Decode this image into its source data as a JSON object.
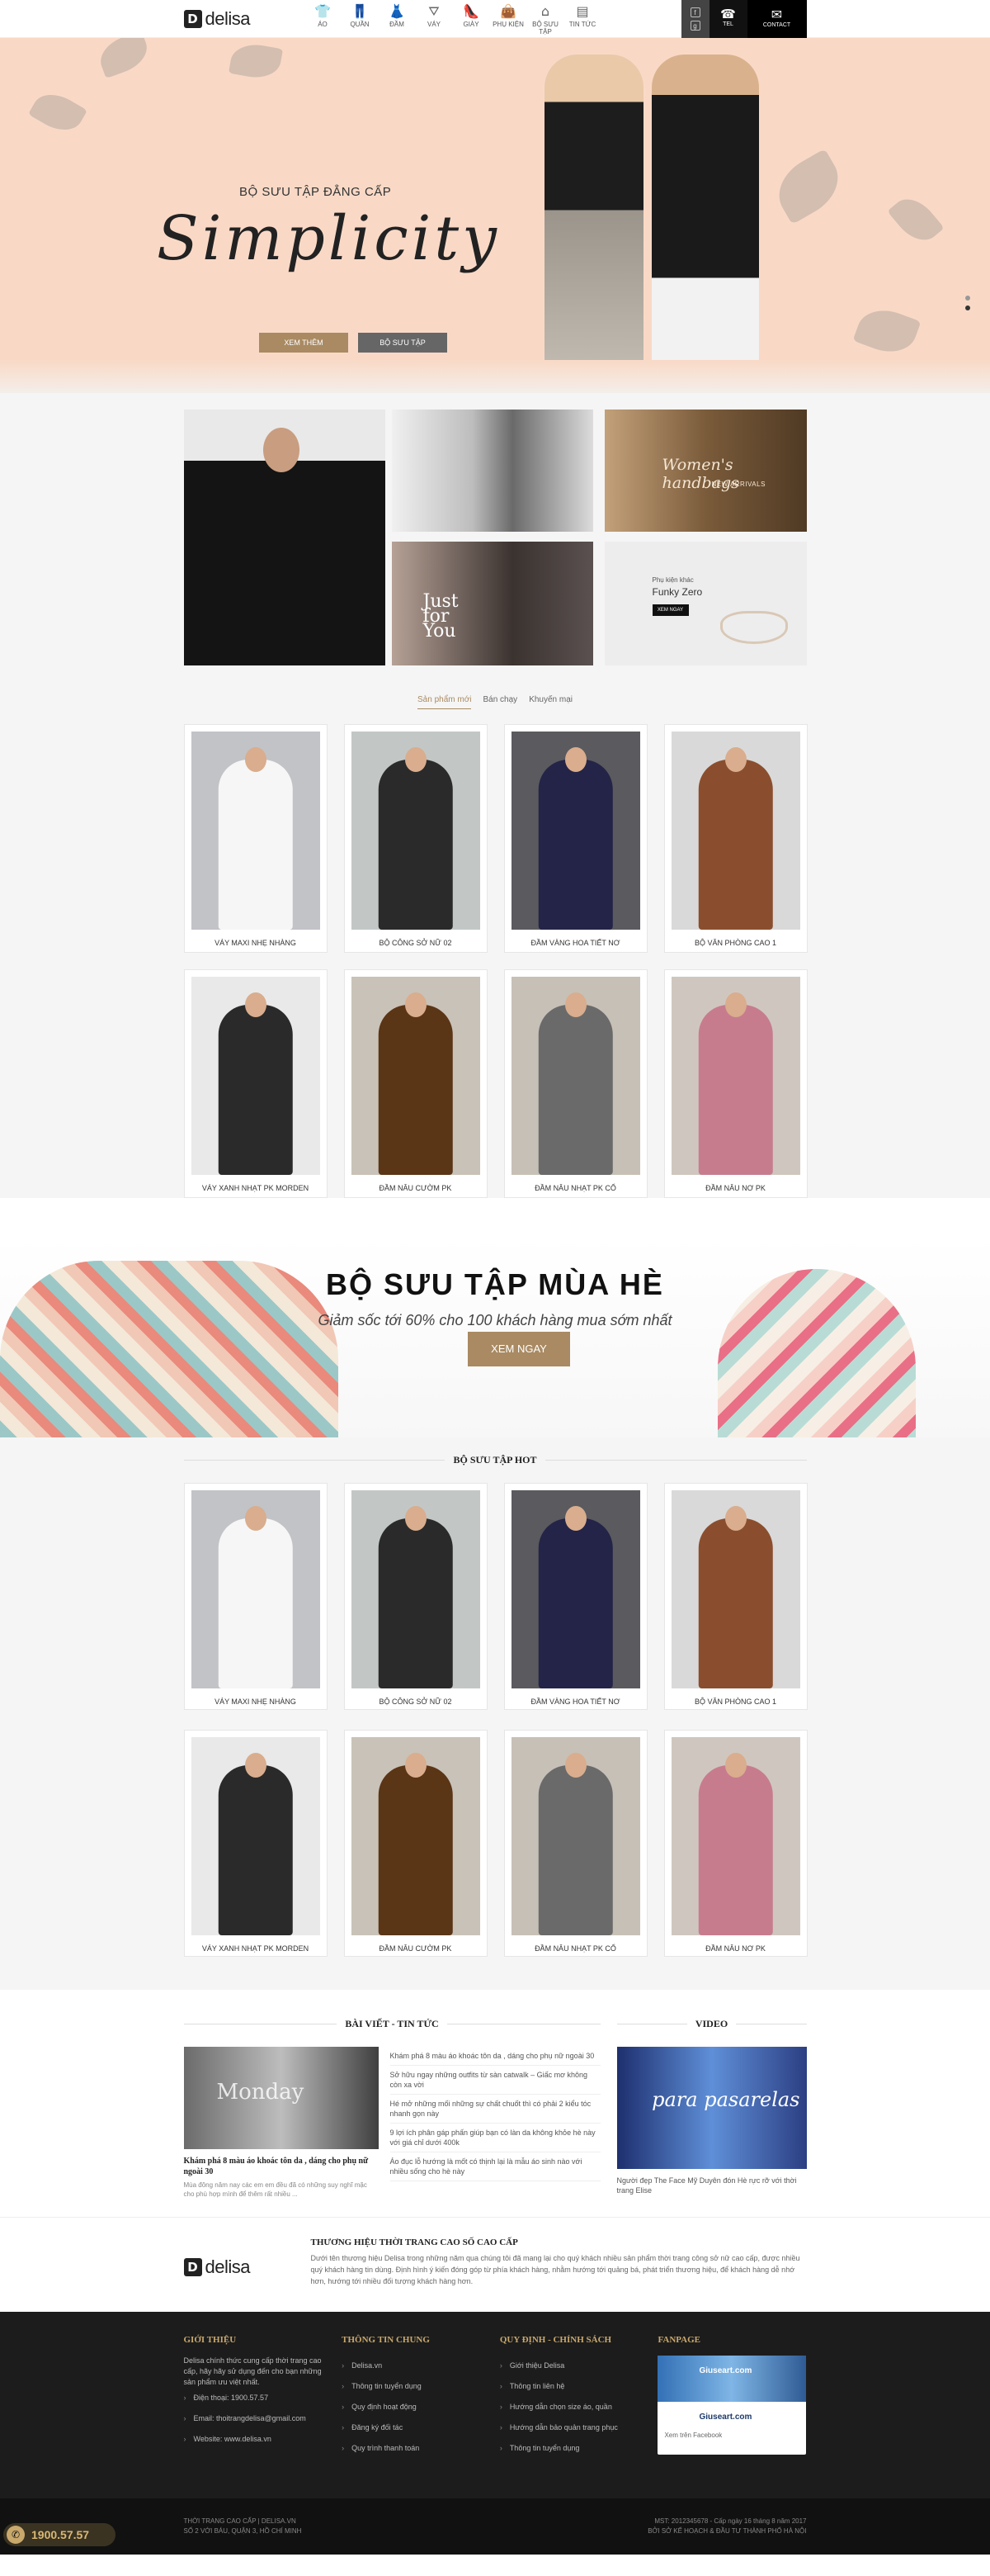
{
  "header": {
    "brand": "delisa",
    "brand_mark": "D",
    "nav": [
      {
        "label": "ÁO",
        "icon": "shirt-icon",
        "glyph": "👕"
      },
      {
        "label": "QUẦN",
        "icon": "trousers-icon",
        "glyph": "👖"
      },
      {
        "label": "ĐẦM",
        "icon": "dress-icon",
        "glyph": "👗"
      },
      {
        "label": "VÁY",
        "icon": "skirt-icon",
        "glyph": "⛛"
      },
      {
        "label": "GIÀY",
        "icon": "shoe-icon",
        "glyph": "👠"
      },
      {
        "label": "PHỤ KIỆN",
        "icon": "handbag-icon",
        "glyph": "👜"
      },
      {
        "label": "BỘ SƯU TẬP",
        "icon": "hanger-icon",
        "glyph": "⌂"
      },
      {
        "label": "TIN TỨC",
        "icon": "news-icon",
        "glyph": "▤"
      }
    ],
    "tel_label": "TEL",
    "contact_label": "CONTACT",
    "social_icons": [
      "facebook-icon",
      "google-plus-icon"
    ]
  },
  "hero": {
    "subtitle": "BỘ SƯU TẬP ĐẲNG CẤP",
    "title": "Simplicity",
    "btn_primary": "XEM THÊM",
    "btn_secondary": "BỘ SƯU TẬP"
  },
  "banners": {
    "handbags_title": "Women's handbags",
    "handbags_sub": "NEW ARRIVALS",
    "justforyou": "Just for You",
    "accessory_kicker": "Phụ kiện khác",
    "accessory_title": "Funky Zero",
    "accessory_btn": "XEM NGAY"
  },
  "tabs": [
    "Sản phẩm mới",
    "Bán chạy",
    "Khuyến mại"
  ],
  "products": [
    {
      "name": "VÁY MAXI NHẸ NHÀNG",
      "colors": [
        "#c2c3c7",
        "#f6f6f6"
      ]
    },
    {
      "name": "BỘ CÔNG SỞ NỮ 02",
      "colors": [
        "#c2c7c6",
        "#2a2a2a"
      ]
    },
    {
      "name": "ĐẦM VÀNG HOA TIẾT NƠ",
      "colors": [
        "#5a5a5f",
        "#232447"
      ]
    },
    {
      "name": "BỘ VĂN PHÒNG CAO 1",
      "colors": [
        "#d9d9d9",
        "#8a4e2e"
      ]
    },
    {
      "name": "VÁY XANH NHẠT PK MORDEN",
      "colors": [
        "#e9e9e9",
        "#2a2a2a"
      ]
    },
    {
      "name": "ĐẦM NÂU CƯỜM PK",
      "colors": [
        "#c9c2b8",
        "#5a3516"
      ]
    },
    {
      "name": "ĐẦM NÂU NHẠT PK CỔ",
      "colors": [
        "#c7c0b6",
        "#6a6a6a"
      ]
    },
    {
      "name": "ĐẦM NÂU NƠ PK",
      "colors": [
        "#cfc7bf",
        "#c77c8e"
      ]
    }
  ],
  "summer": {
    "title": "BỘ SƯU TẬP MÙA HÈ",
    "desc": "Giảm sốc tới 60% cho 100 khách hàng mua sớm nhất",
    "btn": "XEM NGAY"
  },
  "collection": {
    "title": "BỘ SƯU TẬP HOT",
    "products": [
      {
        "name": "VÁY MAXI NHẸ NHÀNG",
        "colors": [
          "#c2c3c7",
          "#f6f6f6"
        ]
      },
      {
        "name": "BỘ CÔNG SỞ NỮ 02",
        "colors": [
          "#c2c7c6",
          "#2a2a2a"
        ]
      },
      {
        "name": "ĐẦM VÀNG HOA TIẾT NƠ",
        "colors": [
          "#5a5a5f",
          "#232447"
        ]
      },
      {
        "name": "BỘ VĂN PHÒNG CAO 1",
        "colors": [
          "#d9d9d9",
          "#8a4e2e"
        ]
      },
      {
        "name": "VÁY XANH NHẠT PK MORDEN",
        "colors": [
          "#e9e9e9",
          "#2a2a2a"
        ]
      },
      {
        "name": "ĐẦM NÂU CƯỜM PK",
        "colors": [
          "#c9c2b8",
          "#5a3516"
        ]
      },
      {
        "name": "ĐẦM NÂU NHẠT PK CỔ",
        "colors": [
          "#c7c0b6",
          "#6a6a6a"
        ]
      },
      {
        "name": "ĐẦM NÂU NƠ PK",
        "colors": [
          "#cfc7bf",
          "#c77c8e"
        ]
      }
    ]
  },
  "news": {
    "title": "BÀI VIẾT - TIN TỨC",
    "featured_image_text": "Monday",
    "featured_title": "Khám phá 8 màu áo khoác tôn da , dáng cho phụ nữ ngoài 30",
    "featured_desc": "Mùa đông năm nay các em em đều đã có những suy nghĩ mặc cho phù hợp mình để thêm rất nhiều ...",
    "items": [
      "Khám phá 8 màu áo khoác tôn da , dáng cho phụ nữ ngoài 30",
      "Sở hữu ngay những outfits từ sàn catwalk – Giấc mơ không còn xa vời",
      "Hé mở những mối những sự chất chuốt thì có phải 2 kiểu tóc nhanh gọn này",
      "9 lợi ích phân gáp phấn giúp bạn có làn da không khỏe hè này với giá chỉ dưới 400k",
      "Áo đục lỗ hướng là mốt có thịnh lại là mẫu áo sinh nào với nhiều sống cho hè này"
    ]
  },
  "video": {
    "title": "VIDEO",
    "thumb_text": "para pasarelas",
    "caption": "Người đẹp The Face Mỹ Duyên đón Hè rực rỡ với thời trang Elise"
  },
  "brand": {
    "title": "THƯƠNG HIỆU THỜI TRANG CAO SỐ CAO CẤP",
    "desc": "Dưới tên thương hiệu Delisa trong những năm qua chúng tôi đã mang lại cho quý khách nhiều sản phẩm thời trang công sở nữ cao cấp, được nhiều quý khách hàng tin dùng. Định hình ý kiến đóng góp từ phía khách hàng, nhằm hướng tới quảng bá, phát triển thương hiệu, để khách hàng dễ nhớ hơn, hướng tới nhiều đối tượng khách hàng hơn."
  },
  "footer": {
    "about_title": "GIỚI THIỆU",
    "about_text": "Delisa chính thức cung cấp thời trang cao cấp, hãy hãy sử dụng đến cho bạn những sản phẩm ưu việt nhất.",
    "phone": "Điện thoại: 1900.57.57",
    "email": "Email: thoitrangdelisa@gmail.com",
    "website": "Website: www.delisa.vn",
    "info_title": "THÔNG TIN CHUNG",
    "info_items": [
      "Delisa.vn",
      "Thông tin tuyển dụng",
      "Quy định hoạt động",
      "Đăng ký đối tác",
      "Quy trình thanh toán"
    ],
    "policy_title": "QUY ĐỊNH - CHÍNH SÁCH",
    "policy_items": [
      "Giới thiệu Delisa",
      "Thông tin liên hệ",
      "Hướng dẫn chọn size áo, quần",
      "Hướng dẫn bảo quản trang phục",
      "Thông tin tuyển dụng"
    ],
    "fanpage_title": "FANPAGE",
    "fb_name": "Giuseart.com",
    "fb_link": "Xem trên Facebook",
    "copyright_left": "THỜI TRANG CAO CẤP  |  DELISA.VN\nSỐ 2 VỚI BÁU, QUẬN 3, HỒ CHÍ MINH",
    "copyright_right": "MST: 2012345678 - Cấp ngày 16 tháng 8 năm 2017\nBỞI SỞ KẾ HOẠCH & ĐẦU TƯ THÀNH PHỐ HÀ NỘI",
    "hotline": "1900.57.57"
  },
  "colors": {
    "accent": "#a98a62",
    "hero_bg": "#f9d9c6",
    "footer_bg": "#1c1c1c",
    "gold": "#c9a86c"
  }
}
